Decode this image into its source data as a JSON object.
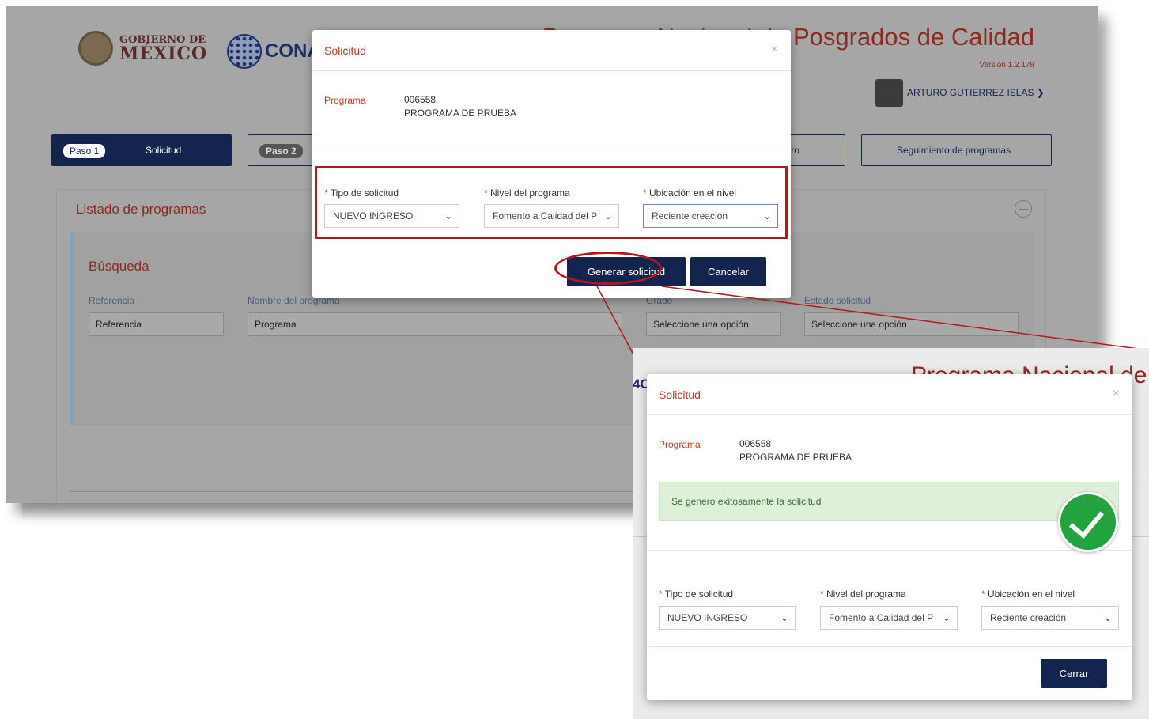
{
  "header": {
    "gob_line1": "GOBIERNO DE",
    "gob_line2": "MÉXICO",
    "conacyt": "CONAC",
    "title": "Programa Nacional de Posgrados de Calidad",
    "version": "Versión 1.2.178",
    "user_name": "ARTURO GUTIERREZ ISLAS ❯"
  },
  "steps": {
    "step1_pill": "Paso 1",
    "step1_label": "Solicitud",
    "step2_pill": "Paso 2",
    "track_label": "tro",
    "seguimiento": "Seguimiento de programas"
  },
  "listado": {
    "title": "Listado de programas",
    "search_title": "Búsqueda",
    "ref_label": "Referencia",
    "ref_placeholder": "Referencia",
    "name_label": "Nombre del programa",
    "name_placeholder": "Programa",
    "grado_label": "Grado",
    "grado_value": "Seleccione una opción",
    "estado_label": "Estado solicitud",
    "estado_value": "Seleccione una opción"
  },
  "modal": {
    "title": "Solicitud",
    "close": "×",
    "programa_label": "Programa",
    "programa_code": "006558",
    "programa_name": "PROGRAMA DE PRUEBA",
    "tipo_label": "Tipo de solicitud",
    "tipo_value": "NUEVO INGRESO",
    "nivel_label": "Nivel del programa",
    "nivel_value": "Fomento a Calidad del P",
    "ubic_label": "Ubicación en el nivel",
    "ubic_value": "Reciente creación",
    "required_mark": "*",
    "generate_button": "Generar solicitud",
    "cancel_button": "Cancelar"
  },
  "result_modal": {
    "title": "Solicitud",
    "close": "×",
    "success_message": "Se genero exitosamente la solicitud",
    "close_button": "Cerrar"
  },
  "zoom": {
    "bg_title": "Programa Nacional de",
    "bg_logo": "4C"
  },
  "colors": {
    "brand_navy": "#13244f",
    "accent_red": "#b5171f",
    "success_green": "#22a340"
  }
}
